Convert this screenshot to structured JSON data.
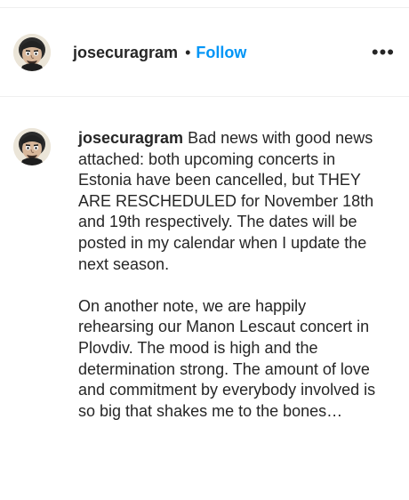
{
  "header": {
    "username": "josecuragram",
    "separator": "•",
    "follow_label": "Follow",
    "more_label": "•••"
  },
  "caption": {
    "username": "josecuragram",
    "paragraphs": [
      "Bad news with good news attached: both upcoming concerts in Estonia have been cancelled, but THEY ARE RESCHEDULED for November 18th and 19th respectively. The dates will be posted in my calendar when I update the next season.",
      "On another note, we are happily rehearsing our Manon Lescaut concert in Plovdiv. The mood is high and the determination strong. The amount of love and commitment by everybody involved is so big that shakes me to the bones…"
    ]
  },
  "icons": {
    "avatar": "caricature-avatar",
    "more": "more-options-icon"
  },
  "colors": {
    "text": "#262626",
    "follow": "#0095f6",
    "divider": "#efefef"
  }
}
